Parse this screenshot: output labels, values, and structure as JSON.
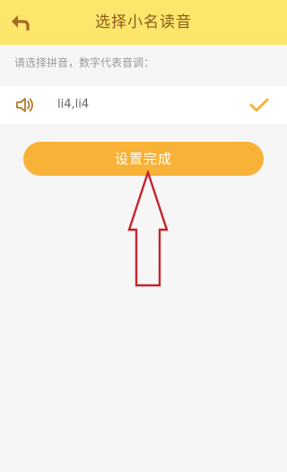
{
  "header": {
    "title": "选择小名读音",
    "back_icon": "back-arrow-icon",
    "background": "#fee56c"
  },
  "hint": "请选择拼音，数字代表音调：",
  "options": [
    {
      "pinyin": "li4,li4",
      "selected": true,
      "speaker_icon": "speaker-icon",
      "check_icon": "check-icon"
    }
  ],
  "done_button": {
    "label": "设置完成",
    "color": "#f7b237"
  },
  "annotation": {
    "icon": "up-arrow-annotation",
    "color": "#c8232c"
  }
}
